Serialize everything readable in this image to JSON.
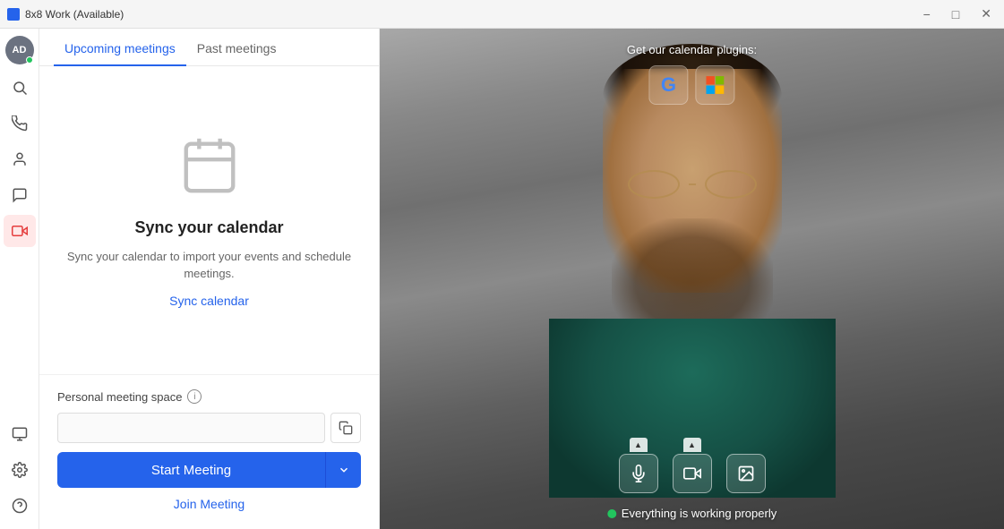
{
  "titlebar": {
    "title": "8x8 Work (Available)",
    "minimize_label": "−",
    "maximize_label": "□",
    "close_label": "✕"
  },
  "sidebar": {
    "avatar_initials": "AD",
    "items": [
      {
        "label": "Search",
        "icon": "🔍",
        "name": "search"
      },
      {
        "label": "Phone",
        "icon": "📞",
        "name": "phone"
      },
      {
        "label": "Contacts",
        "icon": "👤",
        "name": "contacts"
      },
      {
        "label": "Messages",
        "icon": "💬",
        "name": "messages"
      },
      {
        "label": "Meetings",
        "icon": "🎥",
        "name": "meetings",
        "active": true
      }
    ],
    "bottom_items": [
      {
        "label": "Computer",
        "icon": "🖥",
        "name": "computer"
      },
      {
        "label": "Settings",
        "icon": "⚙",
        "name": "settings"
      },
      {
        "label": "Help",
        "icon": "?",
        "name": "help"
      }
    ]
  },
  "tabs": {
    "upcoming": "Upcoming meetings",
    "past": "Past meetings"
  },
  "calendar_sync": {
    "title": "Sync your calendar",
    "description": "Sync your calendar to import your events and schedule meetings.",
    "link_label": "Sync calendar"
  },
  "meeting_space": {
    "label": "Personal meeting space",
    "meeting_id_placeholder": "",
    "start_button": "Start Meeting",
    "join_link": "Join Meeting"
  },
  "camera": {
    "plugins_label": "Get our calendar plugins:",
    "google_icon": "G",
    "microsoft_icon": "⊞",
    "status_text": "Everything is working properly"
  },
  "icons": {
    "search": "⌕",
    "phone": "✆",
    "contacts": "◉",
    "messages": "✉",
    "meetings": "▶",
    "computer": "🖥",
    "settings": "⚙",
    "help": "?",
    "copy": "⧉",
    "mic": "🎤",
    "video": "📹",
    "image": "🖼",
    "chevron_down": "∨"
  }
}
